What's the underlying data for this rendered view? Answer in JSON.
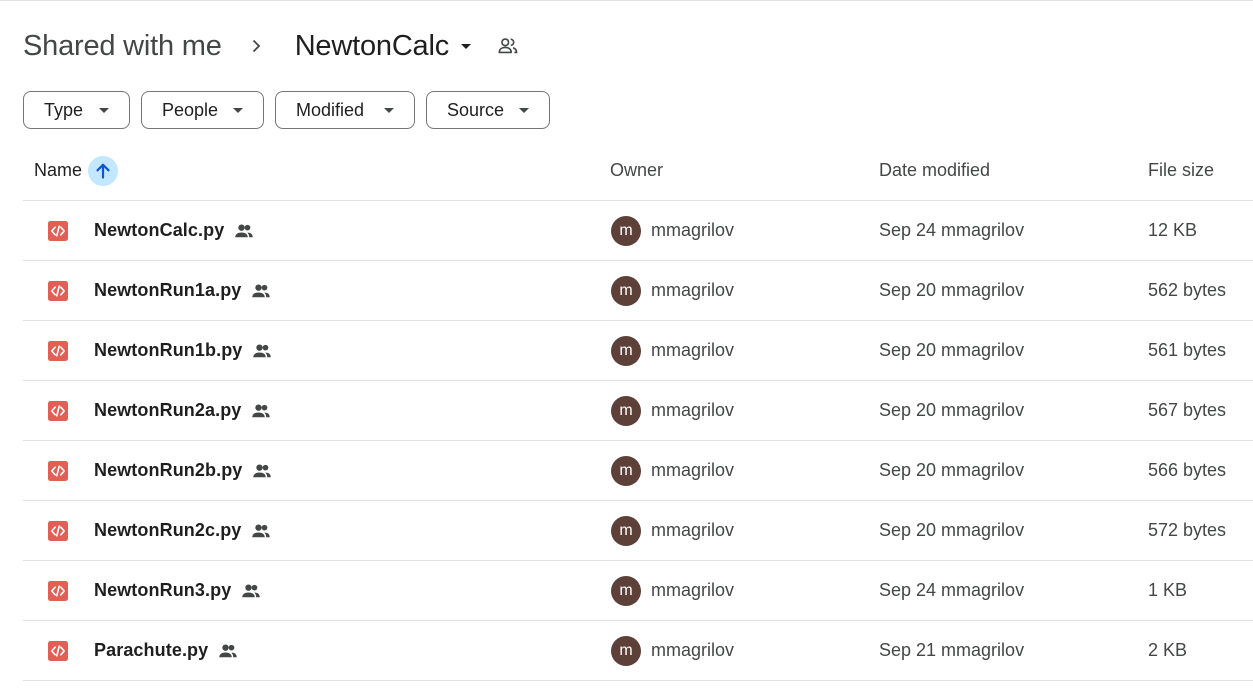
{
  "breadcrumb": {
    "parent": "Shared with me",
    "current": "NewtonCalc"
  },
  "filters": [
    "Type",
    "People",
    "Modified",
    "Source"
  ],
  "columns": {
    "name": "Name",
    "owner": "Owner",
    "date_modified": "Date modified",
    "file_size": "File size"
  },
  "sort": {
    "column": "Name",
    "direction": "ascending"
  },
  "files": [
    {
      "name": "NewtonCalc.py",
      "owner_initial": "m",
      "owner": "mmagrilov",
      "modified": "Sep 24 mmagrilov",
      "size": "12 KB"
    },
    {
      "name": "NewtonRun1a.py",
      "owner_initial": "m",
      "owner": "mmagrilov",
      "modified": "Sep 20 mmagrilov",
      "size": "562 bytes"
    },
    {
      "name": "NewtonRun1b.py",
      "owner_initial": "m",
      "owner": "mmagrilov",
      "modified": "Sep 20 mmagrilov",
      "size": "561 bytes"
    },
    {
      "name": "NewtonRun2a.py",
      "owner_initial": "m",
      "owner": "mmagrilov",
      "modified": "Sep 20 mmagrilov",
      "size": "567 bytes"
    },
    {
      "name": "NewtonRun2b.py",
      "owner_initial": "m",
      "owner": "mmagrilov",
      "modified": "Sep 20 mmagrilov",
      "size": "566 bytes"
    },
    {
      "name": "NewtonRun2c.py",
      "owner_initial": "m",
      "owner": "mmagrilov",
      "modified": "Sep 20 mmagrilov",
      "size": "572 bytes"
    },
    {
      "name": "NewtonRun3.py",
      "owner_initial": "m",
      "owner": "mmagrilov",
      "modified": "Sep 24 mmagrilov",
      "size": "1 KB"
    },
    {
      "name": "Parachute.py",
      "owner_initial": "m",
      "owner": "mmagrilov",
      "modified": "Sep 21 mmagrilov",
      "size": "2 KB"
    }
  ],
  "colors": {
    "file_icon": "#e06055",
    "avatar": "#5d4037",
    "sort_highlight": "#c2e7ff"
  },
  "icons": {
    "file": "code-file-icon",
    "shared": "shared-people-icon",
    "sort": "arrow-up-icon"
  }
}
